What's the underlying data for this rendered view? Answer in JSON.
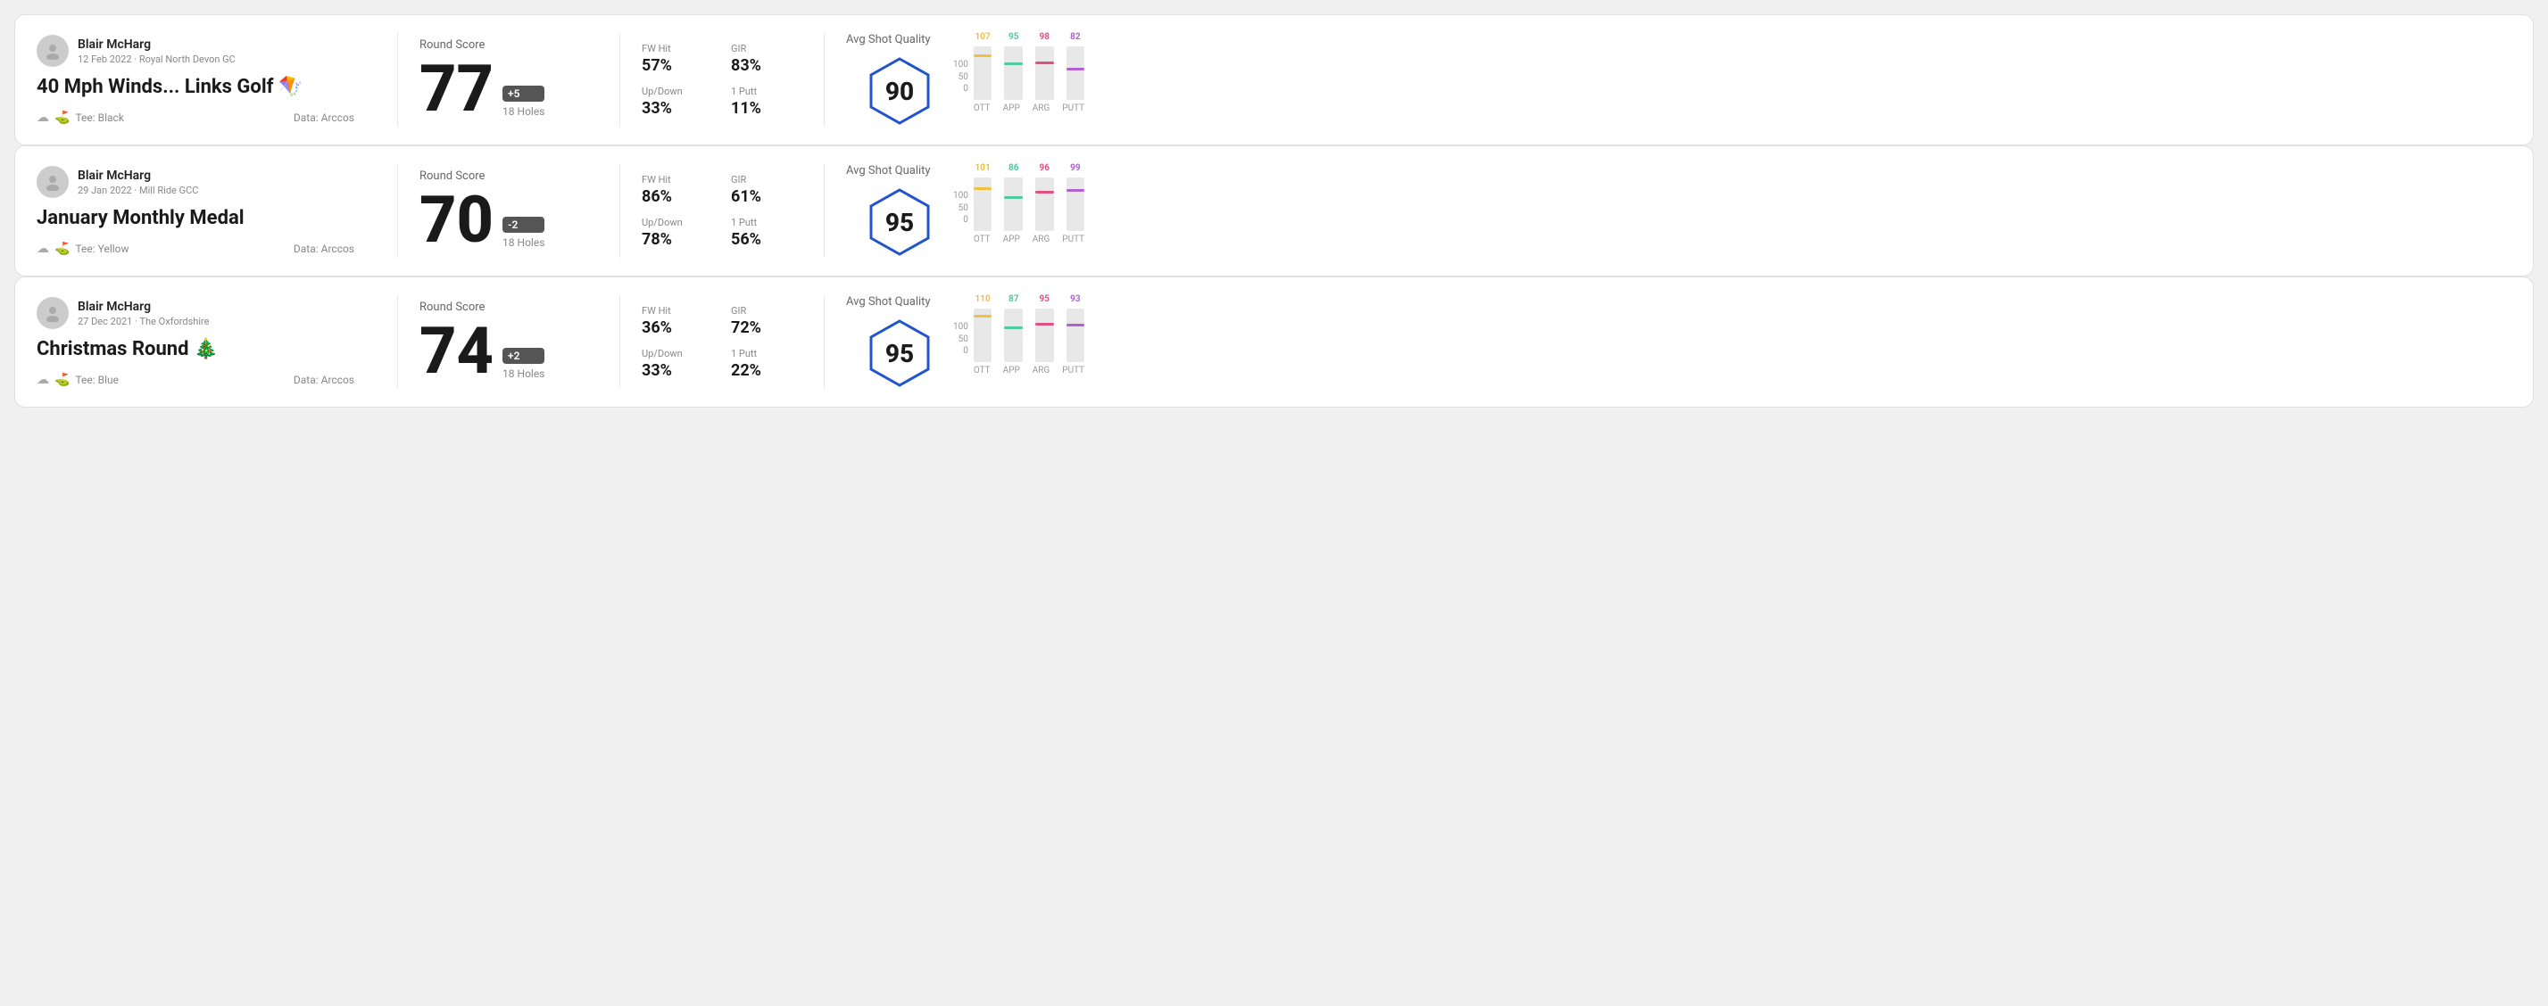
{
  "rounds": [
    {
      "id": "round-1",
      "player": "Blair McHarg",
      "date": "12 Feb 2022",
      "course": "Royal North Devon GC",
      "title": "40 Mph Winds... Links Golf 🪁",
      "tee": "Black",
      "dataSource": "Data: Arccos",
      "score": "77",
      "scoreDiff": "+5",
      "holes": "18 Holes",
      "fwHitLabel": "FW Hit",
      "fwHit": "57%",
      "girLabel": "GIR",
      "gir": "83%",
      "upDownLabel": "Up/Down",
      "upDown": "33%",
      "onePuttLabel": "1 Putt",
      "onePutt": "11%",
      "qualityLabel": "Avg Shot Quality",
      "quality": "90",
      "roundScoreLabel": "Round Score",
      "bars": [
        {
          "label": "OTT",
          "value": 107,
          "color": "#f0c040",
          "pct": 85
        },
        {
          "label": "APP",
          "value": 95,
          "color": "#50c8a0",
          "pct": 70
        },
        {
          "label": "ARG",
          "value": 98,
          "color": "#e05080",
          "pct": 72
        },
        {
          "label": "PUTT",
          "value": 82,
          "color": "#b060d0",
          "pct": 60
        }
      ]
    },
    {
      "id": "round-2",
      "player": "Blair McHarg",
      "date": "29 Jan 2022",
      "course": "Mill Ride GCC",
      "title": "January Monthly Medal",
      "tee": "Yellow",
      "dataSource": "Data: Arccos",
      "score": "70",
      "scoreDiff": "-2",
      "holes": "18 Holes",
      "fwHitLabel": "FW Hit",
      "fwHit": "86%",
      "girLabel": "GIR",
      "gir": "61%",
      "upDownLabel": "Up/Down",
      "upDown": "78%",
      "onePuttLabel": "1 Putt",
      "onePutt": "56%",
      "qualityLabel": "Avg Shot Quality",
      "quality": "95",
      "roundScoreLabel": "Round Score",
      "bars": [
        {
          "label": "OTT",
          "value": 101,
          "color": "#f0c040",
          "pct": 82
        },
        {
          "label": "APP",
          "value": 86,
          "color": "#50c8a0",
          "pct": 65
        },
        {
          "label": "ARG",
          "value": 96,
          "color": "#e05080",
          "pct": 75
        },
        {
          "label": "PUTT",
          "value": 99,
          "color": "#b060d0",
          "pct": 78
        }
      ]
    },
    {
      "id": "round-3",
      "player": "Blair McHarg",
      "date": "27 Dec 2021",
      "course": "The Oxfordshire",
      "title": "Christmas Round 🎄",
      "tee": "Blue",
      "dataSource": "Data: Arccos",
      "score": "74",
      "scoreDiff": "+2",
      "holes": "18 Holes",
      "fwHitLabel": "FW Hit",
      "fwHit": "36%",
      "girLabel": "GIR",
      "gir": "72%",
      "upDownLabel": "Up/Down",
      "upDown": "33%",
      "onePuttLabel": "1 Putt",
      "onePutt": "22%",
      "qualityLabel": "Avg Shot Quality",
      "quality": "95",
      "roundScoreLabel": "Round Score",
      "bars": [
        {
          "label": "OTT",
          "value": 110,
          "color": "#f0c040",
          "pct": 88
        },
        {
          "label": "APP",
          "value": 87,
          "color": "#50c8a0",
          "pct": 66
        },
        {
          "label": "ARG",
          "value": 95,
          "color": "#e05080",
          "pct": 74
        },
        {
          "label": "PUTT",
          "value": 93,
          "color": "#b060d0",
          "pct": 72
        }
      ]
    }
  ],
  "yAxisLabels": [
    "100",
    "50",
    "0"
  ]
}
